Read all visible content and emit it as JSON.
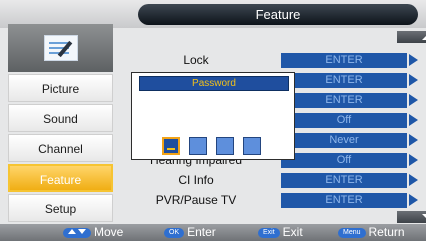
{
  "header": {
    "title": "Feature"
  },
  "sidebar": {
    "items": [
      {
        "label": "Picture"
      },
      {
        "label": "Sound"
      },
      {
        "label": "Channel"
      },
      {
        "label": "Feature"
      },
      {
        "label": "Setup"
      }
    ]
  },
  "rows": [
    {
      "label": "Lock",
      "value": "ENTER"
    },
    {
      "label": "",
      "value": "ENTER"
    },
    {
      "label": "",
      "value": "ENTER"
    },
    {
      "label": "",
      "value": "Off"
    },
    {
      "label": "",
      "value": "Never"
    },
    {
      "label": "Hearing Impaired",
      "value": "Off"
    },
    {
      "label": "CI Info",
      "value": "ENTER"
    },
    {
      "label": "PVR/Pause TV",
      "value": "ENTER"
    }
  ],
  "popup": {
    "title": "Password"
  },
  "footer": {
    "move": "Move",
    "enter": "Enter",
    "exit": "Exit",
    "return": "Return",
    "ok_key": "OK",
    "exit_key": "Exit",
    "menu_key": "Menu"
  }
}
